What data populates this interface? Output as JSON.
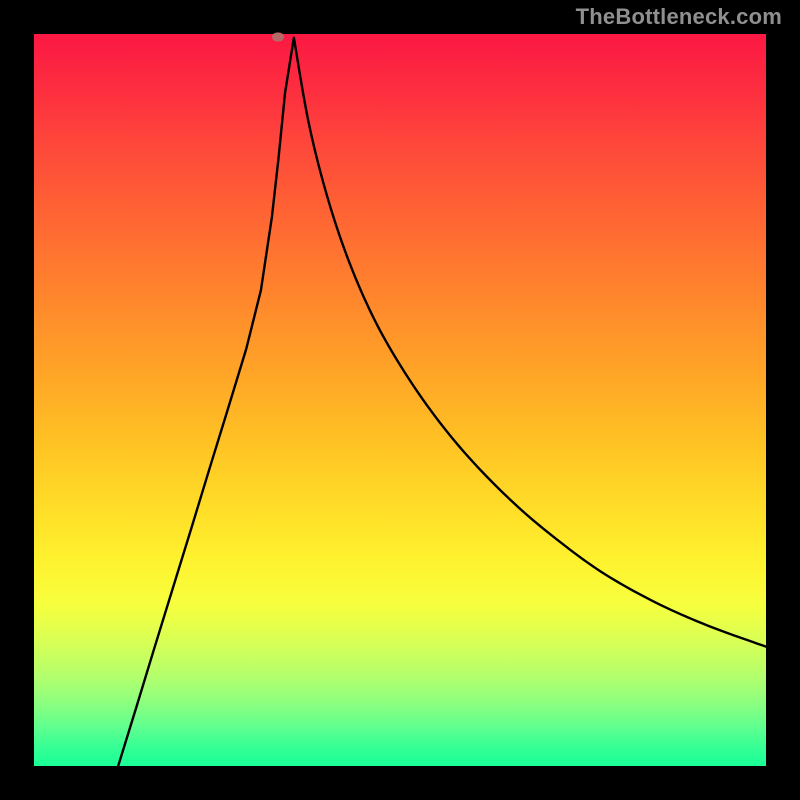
{
  "watermark": "TheBottleneck.com",
  "chart_data": {
    "type": "line",
    "title": "",
    "xlabel": "",
    "ylabel": "",
    "x_range_pct": [
      0,
      100
    ],
    "y_range_pct": [
      0,
      100
    ],
    "grid": false,
    "legend": false,
    "background_gradient": {
      "direction": "vertical",
      "stops": [
        {
          "pct": 0,
          "color": "#fc1843"
        },
        {
          "pct": 50,
          "color": "#ffaa26"
        },
        {
          "pct": 75,
          "color": "#fff22f"
        },
        {
          "pct": 100,
          "color": "#18ff96"
        }
      ]
    },
    "series": [
      {
        "name": "bottleneck-curve",
        "color": "#000000",
        "x_pct": [
          11.5,
          14,
          16.5,
          19,
          21.5,
          24,
          26.5,
          29,
          31,
          32.5,
          33.4,
          34.3,
          35.5,
          37.5,
          40,
          43,
          46.5,
          50.5,
          55,
          60,
          66,
          72,
          78,
          85,
          92,
          100
        ],
        "y_pct": [
          0,
          8.1,
          16.3,
          24.4,
          32.5,
          40.7,
          48.8,
          57,
          65,
          75,
          83,
          92,
          99.5,
          88,
          78,
          69,
          61,
          54,
          47.5,
          41.5,
          35.5,
          30.5,
          26.2,
          22.3,
          19.2,
          16.3
        ]
      }
    ],
    "marker": {
      "x_pct": 33.4,
      "y_pct": 99.6,
      "color": "#b56a69",
      "shape": "oval"
    }
  },
  "colors": {
    "page_bg": "#000000",
    "curve": "#000000",
    "cap": "#b56a69",
    "watermark": "#8f8f8f"
  },
  "icon_names": {
    "none": ""
  }
}
